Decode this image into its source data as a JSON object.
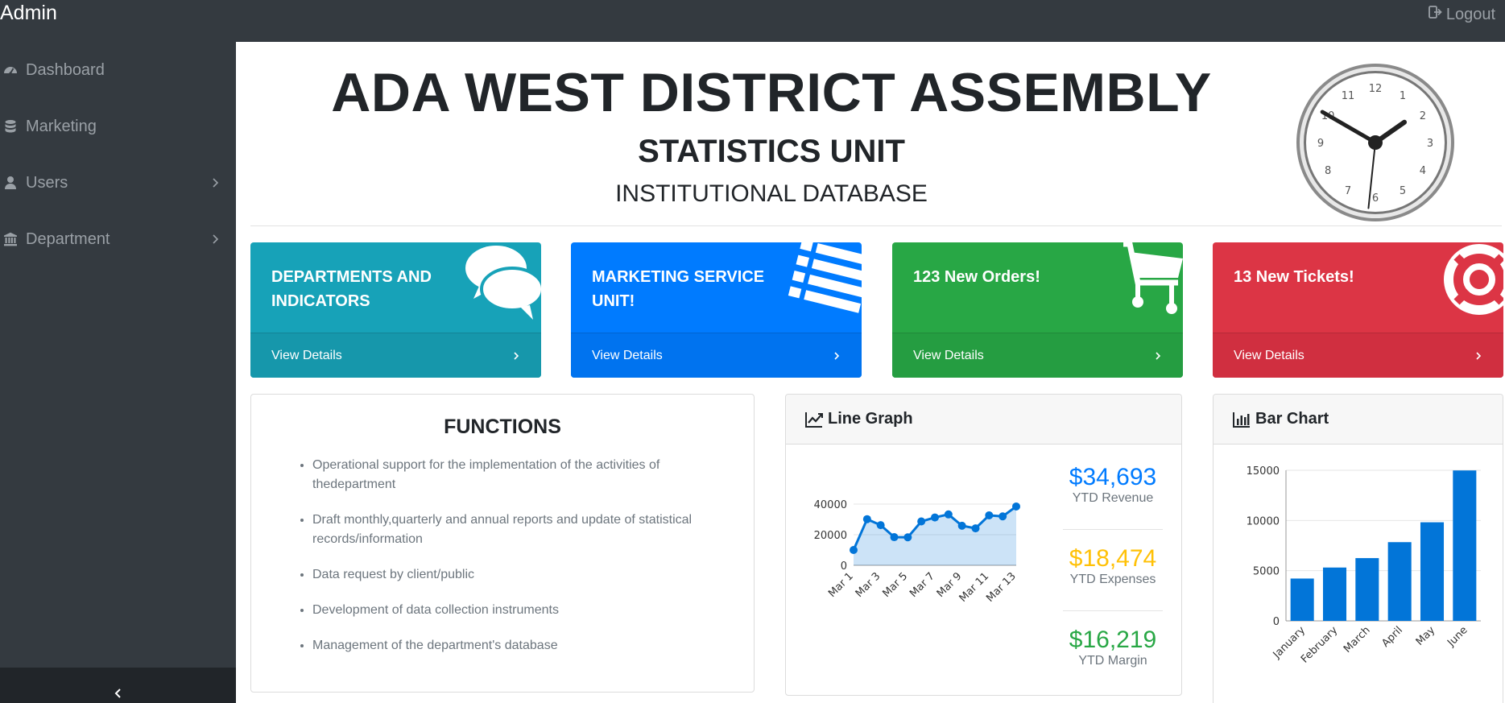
{
  "navbar": {
    "brand": "Admin",
    "logout_label": "Logout"
  },
  "sidebar": {
    "items": [
      {
        "label": "Dashboard",
        "icon": "dashboard-icon"
      },
      {
        "label": "Marketing",
        "icon": "database-icon"
      },
      {
        "label": "Users",
        "icon": "user-icon",
        "has_submenu": true
      },
      {
        "label": "Department",
        "icon": "bank-icon",
        "has_submenu": true
      }
    ]
  },
  "header": {
    "title": "ADA WEST DISTRICT ASSEMBLY",
    "subtitle": "STATISTICS UNIT",
    "tagline": "INSTITUTIONAL DATABASE"
  },
  "clock": {
    "hour_labels": [
      "12",
      "1",
      "2",
      "3",
      "4",
      "5",
      "6",
      "7",
      "8",
      "9",
      "10",
      "11"
    ],
    "hours": 1,
    "minutes": 50,
    "seconds": 31
  },
  "cards": [
    {
      "title": "DEPARTMENTS AND INDICATORS",
      "link": "View Details",
      "color": "#17a2b8",
      "icon": "comments-icon"
    },
    {
      "title": "MARKETING SERVICE UNIT!",
      "link": "View Details",
      "color": "#007bff",
      "icon": "list-icon"
    },
    {
      "title": "123 New Orders!",
      "link": "View Details",
      "color": "#28a745",
      "icon": "shopping-cart-icon"
    },
    {
      "title": "13 New Tickets!",
      "link": "View Details",
      "color": "#dc3545",
      "icon": "life-ring-icon"
    }
  ],
  "functions": {
    "title": "FUNCTIONS",
    "items": [
      "Operational support for the implementation of the activities of thedepartment",
      "Draft monthly,quarterly and annual reports and update of statistical records/information",
      "Data request by client/public",
      "Development of data collection instruments",
      "Management of the department's database"
    ]
  },
  "line_panel": {
    "title": "Line Graph",
    "stats": [
      {
        "value": "$34,693",
        "label": "YTD Revenue",
        "color": "#007bff"
      },
      {
        "value": "$18,474",
        "label": "YTD Expenses",
        "color": "#ffc107"
      },
      {
        "value": "$16,219",
        "label": "YTD Margin",
        "color": "#28a745"
      }
    ]
  },
  "bar_panel": {
    "title": "Bar Chart"
  },
  "chart_data": [
    {
      "type": "area",
      "title": "Line Graph",
      "x": [
        "Mar 1",
        "Mar 2",
        "Mar 3",
        "Mar 4",
        "Mar 5",
        "Mar 6",
        "Mar 7",
        "Mar 8",
        "Mar 9",
        "Mar 10",
        "Mar 11",
        "Mar 12",
        "Mar 13"
      ],
      "x_tick_labels": [
        "Mar 1",
        "Mar 3",
        "Mar 5",
        "Mar 7",
        "Mar 9",
        "Mar 11",
        "Mar 13"
      ],
      "values": [
        10000,
        30162,
        26263,
        18394,
        18287,
        28682,
        31274,
        33259,
        25849,
        24159,
        32651,
        31984,
        38451
      ],
      "y_ticks": [
        0,
        20000,
        40000
      ],
      "ylim": [
        0,
        40000
      ],
      "color": "#0275d8",
      "grid": true
    },
    {
      "type": "bar",
      "title": "Bar Chart",
      "categories": [
        "January",
        "February",
        "March",
        "April",
        "May",
        "June"
      ],
      "values": [
        4215,
        5312,
        6251,
        7841,
        9821,
        14984
      ],
      "y_ticks": [
        0,
        5000,
        10000,
        15000
      ],
      "ylim": [
        0,
        15000
      ],
      "color": "#0275d8",
      "grid": true
    }
  ]
}
